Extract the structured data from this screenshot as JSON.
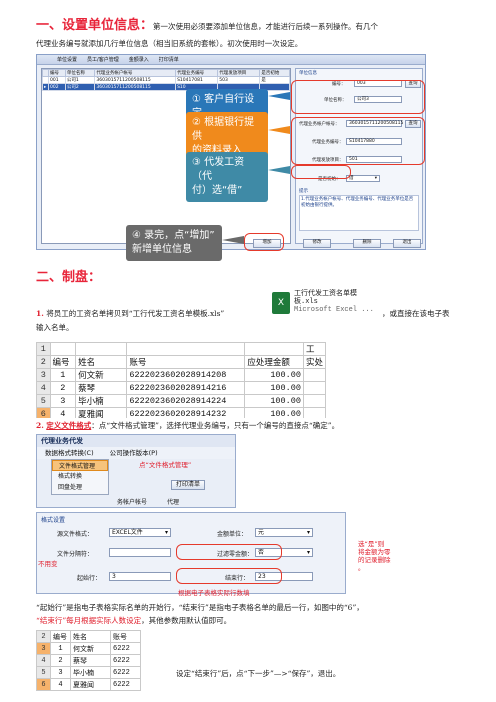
{
  "section1": {
    "heading": "一、设置单位信息：",
    "intro_line1": "第一次使用必须要添加单位信息，才能进行后续一系列操作。有几个",
    "intro_line2": "代理业务编号就添加几行单位信息（相当旧系统的套帐）。初次使用时一次设定。"
  },
  "unit_window": {
    "tabs": [
      "单位设置",
      "员工/客户管理",
      "金额录入",
      "打印清单"
    ],
    "columns": [
      "编号",
      "单位名称",
      "代理业务帐户帐号",
      "代理业务编号",
      "代理发放项目",
      "是否初始"
    ],
    "rows": [
      [
        "001",
        "公司1",
        "3603015711200508115",
        "S10417081",
        "503",
        "是"
      ],
      [
        "002",
        "公司2",
        "3603015711200508115",
        "S10",
        "",
        ""
      ]
    ],
    "form_title": "单位信息",
    "fields": {
      "code_label": "编号：",
      "code_value": "003",
      "name_label": "单位名称：",
      "name_value": "公司3",
      "account_label": "代理业务帐户帐号：",
      "account_value": "3603015711200508115",
      "biz_label": "代理业务编号：",
      "biz_value": "S10417880",
      "item_label": "代理发放项目：",
      "item_value": "501",
      "init_label": "是否初始：",
      "init_value": "借"
    },
    "button_check": "查询",
    "tips_title": "提示",
    "tips_text": "1.代理业务帐户帐号、代理业务编号、代理业务单位是否初始由银行提供。",
    "buttons": [
      "增加",
      "修改",
      "删除",
      "退出"
    ]
  },
  "callouts": {
    "c1": "①  客户自行设定",
    "c2a": "② 根据银行提供",
    "c2b": "的资料录入",
    "c3a": "③ 代发工资（代",
    "c3b": "付）选“借”",
    "c4a": "④ 录完，点“增加”",
    "c4b": "新增单位信息"
  },
  "section2": {
    "heading": "二、制盘：",
    "step1_num": "1.",
    "step1_a": "将员工的工资名单拷贝到“工行代发工资名单模板.xls”",
    "step1_b": "，或直接在该电子表",
    "step1_c": "输入名单。",
    "xls_icon_title": "工行代发工资名单模",
    "xls_icon_ext": "板.xls",
    "xls_icon_app": "Microsoft Excel ..."
  },
  "excel1": {
    "col_headers": [
      "A",
      "B",
      "C",
      "D"
    ],
    "header_row": [
      "编号",
      "姓名",
      "账号",
      "应处理金额",
      "实处"
    ],
    "rows": [
      {
        "rn": "3",
        "no": "1",
        "name": "何文新",
        "acct": "6222023602028914208",
        "amt": "100.00"
      },
      {
        "rn": "4",
        "no": "2",
        "name": "蔡琴",
        "acct": "6222023602028914216",
        "amt": "100.00"
      },
      {
        "rn": "5",
        "no": "3",
        "name": "毕小楠",
        "acct": "6222023602028914224",
        "amt": "100.00"
      },
      {
        "rn": "6",
        "no": "4",
        "name": "夏雅闻",
        "acct": "6222023602028914232",
        "amt": "100.00"
      }
    ],
    "row_nums": [
      "1",
      "2"
    ],
    "corner_label": "工"
  },
  "step2": {
    "num": "2.",
    "title": "定义文件格式",
    "text": "：点“文件格式管理”，选择代理业务编号，只有一个编号的直接点“确定”。"
  },
  "menu_window": {
    "bar_title": "代理业务代发",
    "menu_items": [
      "数据格式转换(C)",
      "公司操作版本(P)"
    ],
    "sub_items": [
      "文件格式管理",
      "格式转换",
      "回盘处理"
    ],
    "side_btn": "打印清单",
    "annot": "点“文件格式管理”",
    "col_tail": [
      "务帐户帐号",
      "代理"
    ]
  },
  "format_window": {
    "title": "格式设置",
    "file_fmt_label": "源文件格式：",
    "file_fmt_value": "EXCEL文件",
    "sep_label": "文件分隔符：",
    "amount_label": "金额单位：",
    "amount_value": "元",
    "filter_label": "过滤零金额：",
    "filter_value": "否",
    "start_label": "起始行：",
    "start_value": "3",
    "end_label": "结束行：",
    "end_value": "23",
    "annot_left": "不用变",
    "annot_right1": "选“是”则",
    "annot_right2": "将金额为零",
    "annot_right3": "的记录删除",
    "annot_right4": "。",
    "annot_bottom": "根据电子表格实际行数填"
  },
  "explain": {
    "line1": "“起始行”是指电子表格实际名单的开始行，“结束行”是指电子表格名单的最后一行，如图中的“6”，",
    "line2_red": "“结束行”每月根据实际人数设定",
    "line2_rest": "，其他参数用默认值即可。"
  },
  "excel2": {
    "col_headers": [
      "A",
      "B",
      "C",
      "D"
    ],
    "header_row": [
      "编号",
      "姓名",
      "账号"
    ],
    "rows": [
      {
        "rn": "3",
        "no": "1",
        "name": "何文新",
        "acct": "6222"
      },
      {
        "rn": "4",
        "no": "2",
        "name": "蔡琴",
        "acct": "6222"
      },
      {
        "rn": "5",
        "no": "3",
        "name": "毕小楠",
        "acct": "6222"
      },
      {
        "rn": "6",
        "no": "4",
        "name": "夏雅闻",
        "acct": "6222"
      }
    ]
  },
  "final_note": "设定“结束行”后，点“下一步”—>“保存”，退出。"
}
